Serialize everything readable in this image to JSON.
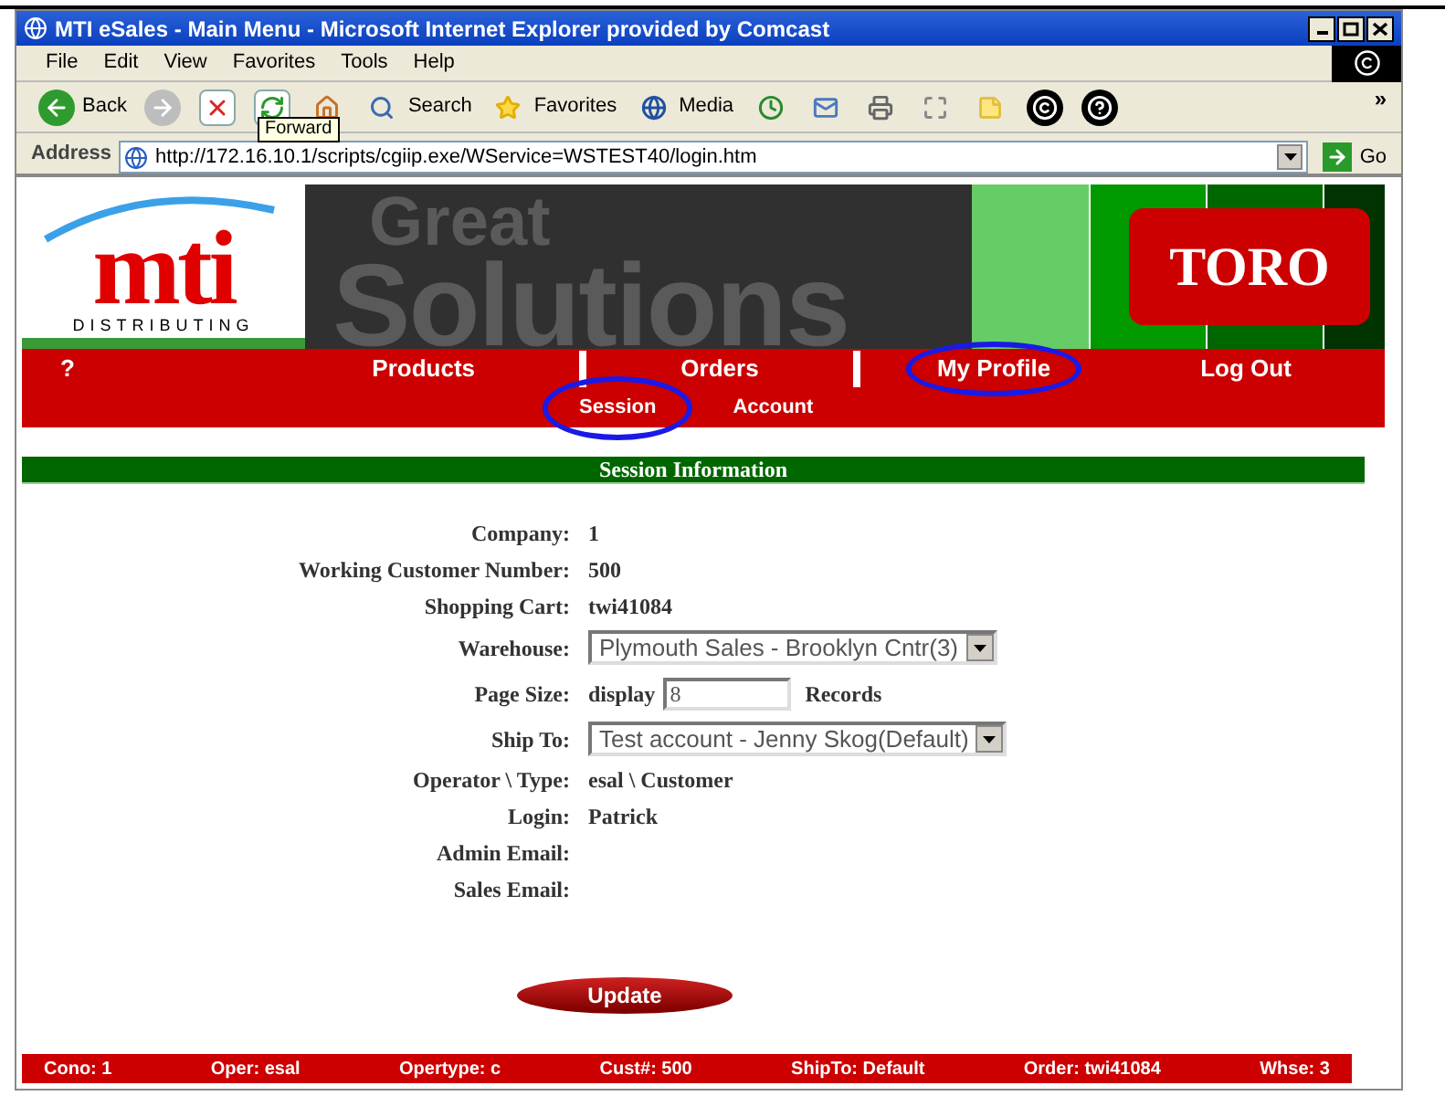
{
  "window": {
    "title": "MTI eSales - Main Menu - Microsoft Internet Explorer provided by Comcast"
  },
  "menu": [
    "File",
    "Edit",
    "View",
    "Favorites",
    "Tools",
    "Help"
  ],
  "toolbar": [
    {
      "kind": "back",
      "label": "Back"
    },
    {
      "kind": "forward"
    },
    {
      "kind": "stop"
    },
    {
      "kind": "refresh"
    },
    {
      "kind": "home"
    },
    {
      "kind": "search",
      "label": "Search"
    },
    {
      "kind": "favorites",
      "label": "Favorites"
    },
    {
      "kind": "media",
      "label": "Media"
    },
    {
      "kind": "history"
    },
    {
      "kind": "mail"
    },
    {
      "kind": "print"
    },
    {
      "kind": "edit"
    },
    {
      "kind": "note"
    },
    {
      "kind": "copyright"
    },
    {
      "kind": "help"
    }
  ],
  "toolbar_overflow": "»",
  "tooltip": "Forward",
  "address": {
    "label": "Address",
    "value": "http://172.16.10.1/scripts/cgiip.exe/WService=WSTEST40/login.htm",
    "go": "Go"
  },
  "brand": {
    "logo": "mti",
    "tagline": "DISTRIBUTING",
    "banner_line_1": "Great",
    "banner_line_2": "Solutions",
    "partner": "TORO"
  },
  "nav": [
    {
      "label": "?",
      "circled": false
    },
    {
      "label": "Products",
      "circled": false
    },
    {
      "label": "Orders",
      "circled": false
    },
    {
      "label": "My Profile",
      "circled": true
    },
    {
      "label": "Log Out",
      "circled": false
    }
  ],
  "subnav": [
    {
      "label": "Session",
      "circled": true
    },
    {
      "label": "Account",
      "circled": false
    }
  ],
  "section_title": "Session Information",
  "fields": [
    {
      "kind": "text",
      "label": "Company:",
      "value": "1"
    },
    {
      "kind": "text",
      "label": "Working Customer Number:",
      "value": "500"
    },
    {
      "kind": "text",
      "label": "Shopping Cart:",
      "value": "twi41084"
    },
    {
      "kind": "select",
      "label": "Warehouse:",
      "value": "Plymouth Sales - Brooklyn Cntr(3)"
    },
    {
      "kind": "input",
      "label": "Page Size:",
      "prefix": "display",
      "value": "8",
      "suffix": "Records"
    },
    {
      "kind": "select",
      "label": "Ship To:",
      "value": "Test account - Jenny Skog(Default)"
    },
    {
      "kind": "text",
      "label": "Operator \\ Type:",
      "value": "esal \\ Customer"
    },
    {
      "kind": "text",
      "label": "Login:",
      "value": "Patrick"
    },
    {
      "kind": "text",
      "label": "Admin Email:"
    },
    {
      "kind": "text",
      "label": "Sales Email:"
    }
  ],
  "update_button": "Update",
  "status_bar": [
    "Cono: 1",
    "Oper: esal",
    "Opertype: c",
    "Cust#: 500",
    "ShipTo: Default",
    "Order: twi41084",
    "Whse: 3"
  ]
}
